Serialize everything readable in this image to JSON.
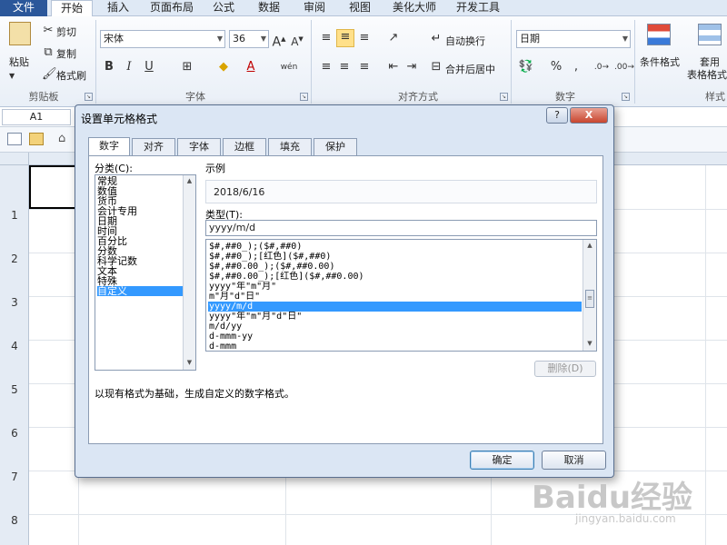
{
  "ribbon_tabs": [
    "文件",
    "开始",
    "插入",
    "页面布局",
    "公式",
    "数据",
    "审阅",
    "视图",
    "美化大师",
    "开发工具"
  ],
  "ribbon": {
    "clipboard": {
      "paste": "粘贴",
      "cut": "剪切",
      "copy": "复制",
      "format_painter": "格式刷",
      "group": "剪贴板"
    },
    "font": {
      "name": "宋体",
      "size": "36",
      "group": "字体"
    },
    "alignment": {
      "wrap": "自动换行",
      "merge": "合并后居中",
      "group": "对齐方式"
    },
    "number": {
      "format": "日期",
      "group": "数字"
    },
    "styles": {
      "conditional": "条件格式",
      "table_top": "套用",
      "table_bottom": "表格格式",
      "group": "样式"
    }
  },
  "name_box": "A1",
  "row_numbers": [
    "1",
    "2",
    "3",
    "4",
    "5",
    "6",
    "7",
    "8"
  ],
  "dialog": {
    "title": "设置单元格格式",
    "help": "?",
    "close": "X",
    "tabs": [
      "数字",
      "对齐",
      "字体",
      "边框",
      "填充",
      "保护"
    ],
    "category_label": "分类(C):",
    "categories": [
      "常规",
      "数值",
      "货币",
      "会计专用",
      "日期",
      "时间",
      "百分比",
      "分数",
      "科学记数",
      "文本",
      "特殊",
      "自定义"
    ],
    "selected_category": "自定义",
    "sample_label": "示例",
    "sample_value": "2018/6/16",
    "type_label": "类型(T):",
    "type_value": "yyyy/m/d",
    "formats": [
      "$#,##0_);($#,##0)",
      "$#,##0_);[红色]($#,##0)",
      "$#,##0.00_);($#,##0.00)",
      "$#,##0.00_);[红色]($#,##0.00)",
      "yyyy\"年\"m\"月\"",
      "m\"月\"d\"日\"",
      "yyyy/m/d",
      "yyyy\"年\"m\"月\"d\"日\"",
      "m/d/yy",
      "d-mmm-yy",
      "d-mmm"
    ],
    "selected_format": "yyyy/m/d",
    "delete_label": "删除(D)",
    "description": "以现有格式为基础，生成自定义的数字格式。",
    "ok_label": "确定",
    "cancel_label": "取消"
  },
  "watermark": {
    "main": "Baidu经验",
    "sub": "jingyan.baidu.com"
  },
  "colors": {
    "file_tab": "#2b579a",
    "selection": "#3399ff",
    "dialog_bg": "#dbe6f4"
  }
}
